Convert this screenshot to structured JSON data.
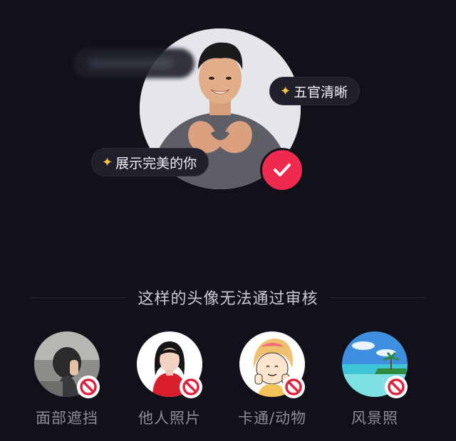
{
  "hero": {
    "blurred_tag": "",
    "tag_features": "五官清晰",
    "tag_show": "展示完美的你",
    "sparkle_icon": "sparkle-icon",
    "check_icon": "check-icon",
    "accent": "#f0294e",
    "sparkle_color": "#f5c542"
  },
  "section": {
    "title": "这样的头像无法通过审核"
  },
  "examples": [
    {
      "label": "面部遮挡",
      "icon": "no-entry-icon"
    },
    {
      "label": "他人照片",
      "icon": "no-entry-icon"
    },
    {
      "label": "卡通/动物",
      "icon": "no-entry-icon"
    },
    {
      "label": "风景照",
      "icon": "no-entry-icon"
    }
  ],
  "colors": {
    "background": "#11111a",
    "label": "#8d8e99",
    "title": "#c9cad3"
  }
}
